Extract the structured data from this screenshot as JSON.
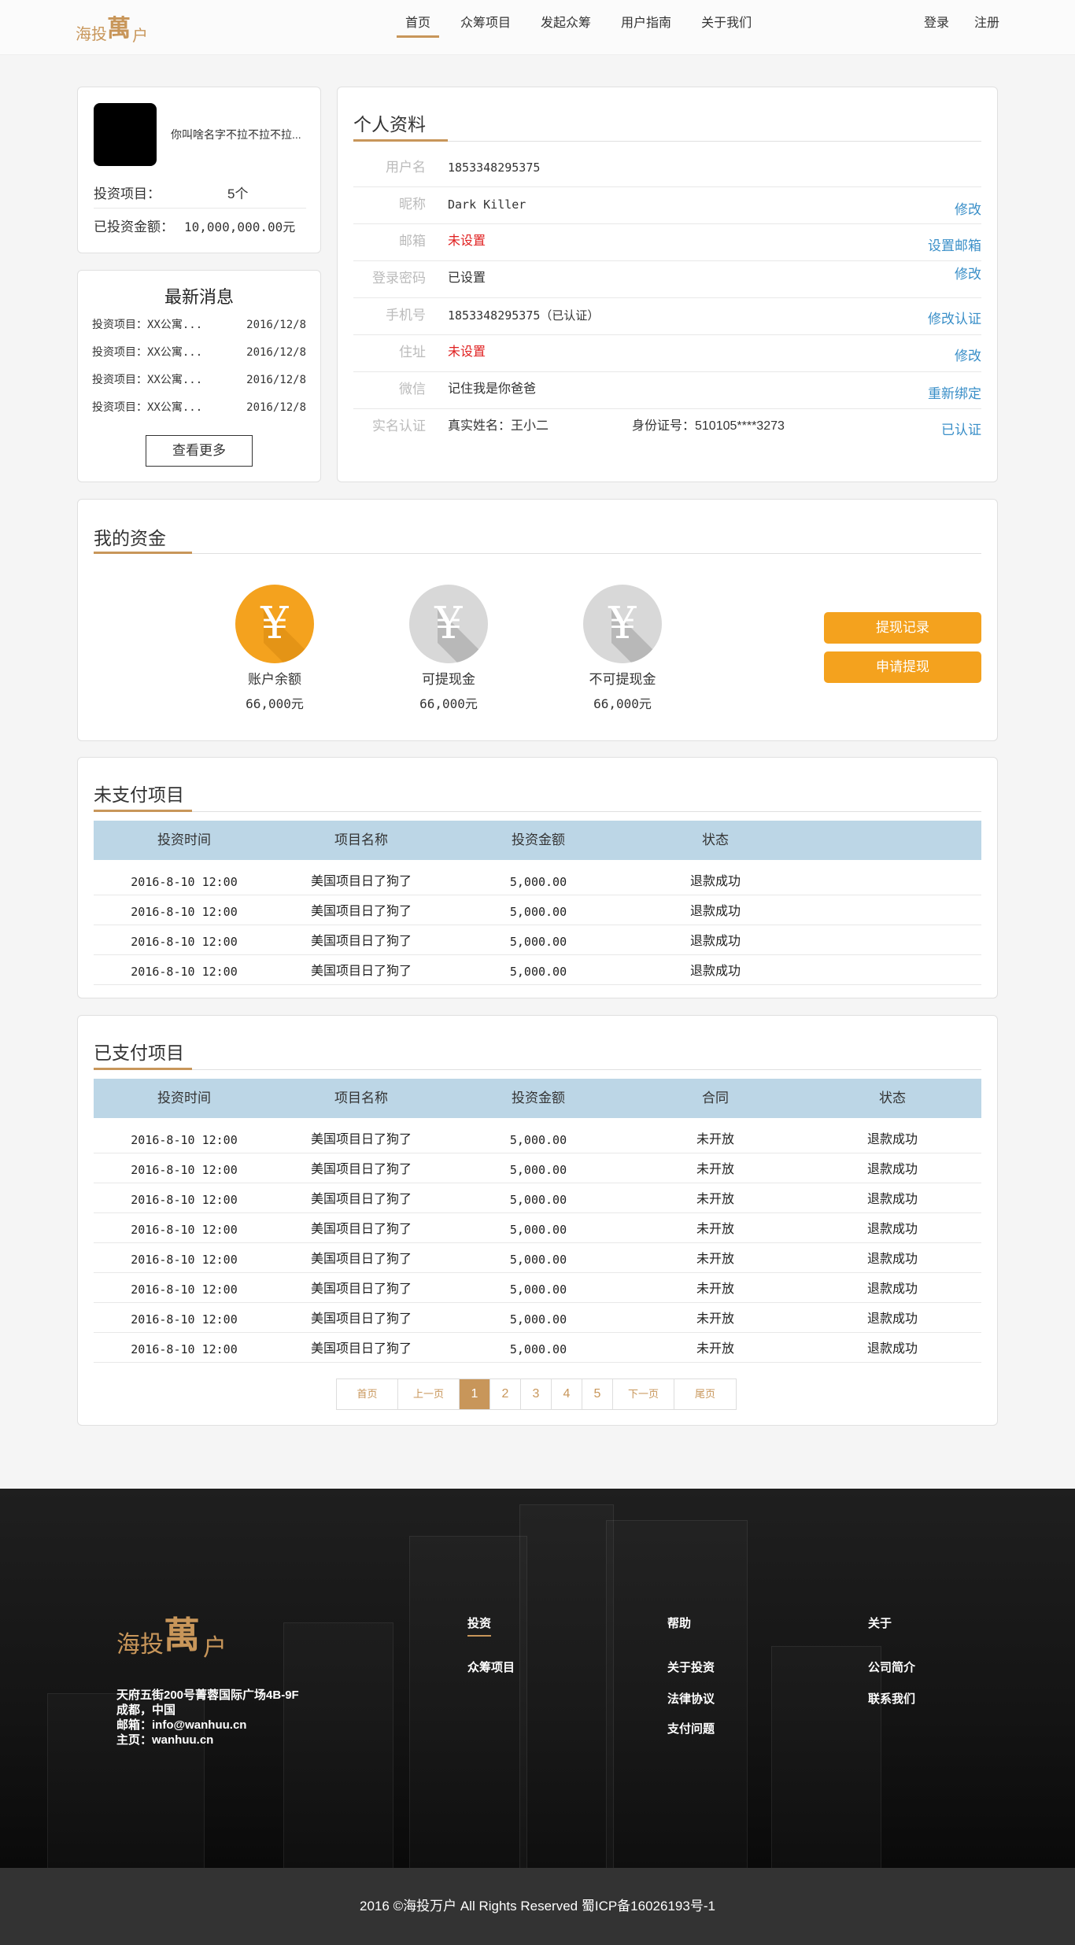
{
  "nav": {
    "logo_text": "海投萬户",
    "items": [
      {
        "label": "首页"
      },
      {
        "label": "众筹项目"
      },
      {
        "label": "发起众筹"
      },
      {
        "label": "用户指南"
      },
      {
        "label": "关于我们"
      }
    ],
    "login": "登录",
    "register": "注册",
    "accent": "#c8965a"
  },
  "profile_card": {
    "username": "你叫啥名字不拉不拉不拉...",
    "invest_projects_label": "投资项目：",
    "invest_projects_value": "5个",
    "invested_amount_label": "已投资金额：",
    "invested_amount_value": "10,000,000.00元"
  },
  "news": {
    "title": "最新消息",
    "items": [
      {
        "text": "投资项目：XX公寓...",
        "date": "2016/12/8"
      },
      {
        "text": "投资项目：XX公寓...",
        "date": "2016/12/8"
      },
      {
        "text": "投资项目：XX公寓...",
        "date": "2016/12/8"
      },
      {
        "text": "投资项目：XX公寓...",
        "date": "2016/12/8"
      }
    ],
    "more": "查看更多"
  },
  "personal": {
    "title": "个人资料",
    "rows": [
      {
        "key": "用户名",
        "value": "1853348295375",
        "action": ""
      },
      {
        "key": "昵称",
        "value": "Dark Killer",
        "action": "修改"
      },
      {
        "key": "邮箱",
        "value": "未设置",
        "action": "设置邮箱"
      },
      {
        "key": "登录密码",
        "value": "已设置",
        "action": "修改"
      },
      {
        "key": "手机号",
        "value": "1853348295375（已认证）",
        "action": "修改认证"
      },
      {
        "key": "住址",
        "value": "未设置",
        "action": "修改"
      },
      {
        "key": "微信",
        "value": "记住我是你爸爸",
        "action": "重新绑定"
      },
      {
        "key": "实名认证",
        "value": "真实姓名：王小二",
        "value2": "身份证号：510105****3273",
        "action": "已认证"
      }
    ]
  },
  "funds": {
    "title": "我的资金",
    "items": [
      {
        "label": "账户余额",
        "amount": "66,000元",
        "icon": "yen-coin-icon",
        "color": "#f4a21e"
      },
      {
        "label": "可提现金",
        "amount": "66,000元",
        "icon": "yen-coin-icon",
        "color": "#d8d8d8"
      },
      {
        "label": "不可提现金",
        "amount": "66,000元",
        "icon": "yen-coin-icon",
        "color": "#d8d8d8"
      }
    ],
    "yen": "¥",
    "withdraw_records": "提现记录",
    "apply_withdraw": "申请提现",
    "button_color": "#f4a21e"
  },
  "unpaid": {
    "title": "未支付项目",
    "headers": [
      "投资时间",
      "项目名称",
      "投资金额",
      "状态"
    ],
    "rows": [
      [
        "2016-8-10 12:00",
        "美国项目日了狗了",
        "5,000.00",
        "退款成功"
      ],
      [
        "2016-8-10 12:00",
        "美国项目日了狗了",
        "5,000.00",
        "退款成功"
      ],
      [
        "2016-8-10 12:00",
        "美国项目日了狗了",
        "5,000.00",
        "退款成功"
      ],
      [
        "2016-8-10 12:00",
        "美国项目日了狗了",
        "5,000.00",
        "退款成功"
      ]
    ]
  },
  "paid": {
    "title": "已支付项目",
    "headers": [
      "投资时间",
      "项目名称",
      "投资金额",
      "合同",
      "状态"
    ],
    "rows": [
      [
        "2016-8-10 12:00",
        "美国项目日了狗了",
        "5,000.00",
        "未开放",
        "退款成功"
      ],
      [
        "2016-8-10 12:00",
        "美国项目日了狗了",
        "5,000.00",
        "未开放",
        "退款成功"
      ],
      [
        "2016-8-10 12:00",
        "美国项目日了狗了",
        "5,000.00",
        "未开放",
        "退款成功"
      ],
      [
        "2016-8-10 12:00",
        "美国项目日了狗了",
        "5,000.00",
        "未开放",
        "退款成功"
      ],
      [
        "2016-8-10 12:00",
        "美国项目日了狗了",
        "5,000.00",
        "未开放",
        "退款成功"
      ],
      [
        "2016-8-10 12:00",
        "美国项目日了狗了",
        "5,000.00",
        "未开放",
        "退款成功"
      ],
      [
        "2016-8-10 12:00",
        "美国项目日了狗了",
        "5,000.00",
        "未开放",
        "退款成功"
      ],
      [
        "2016-8-10 12:00",
        "美国项目日了狗了",
        "5,000.00",
        "未开放",
        "退款成功"
      ]
    ]
  },
  "pagination": {
    "first": "首页",
    "prev": "上一页",
    "pages": [
      "1",
      "2",
      "3",
      "4",
      "5"
    ],
    "current": "1",
    "next": "下一页",
    "last": "尾页"
  },
  "footer": {
    "logo_text": "海投萬户",
    "address": [
      "天府五街200号菁蓉国际广场4B-9F",
      "成都，中国",
      "邮箱：info@wanhuu.cn",
      "主页：wanhuu.cn"
    ],
    "columns": [
      {
        "title": "投资",
        "links": [
          "众筹项目"
        ]
      },
      {
        "title": "帮助",
        "links": [
          "关于投资",
          "法律协议",
          "支付问题"
        ]
      },
      {
        "title": "关于",
        "links": [
          "公司简介",
          "联系我们"
        ]
      }
    ],
    "copyright": "2016 ©海投万户 All Rights Reserved  蜀ICP备16026193号-1"
  }
}
